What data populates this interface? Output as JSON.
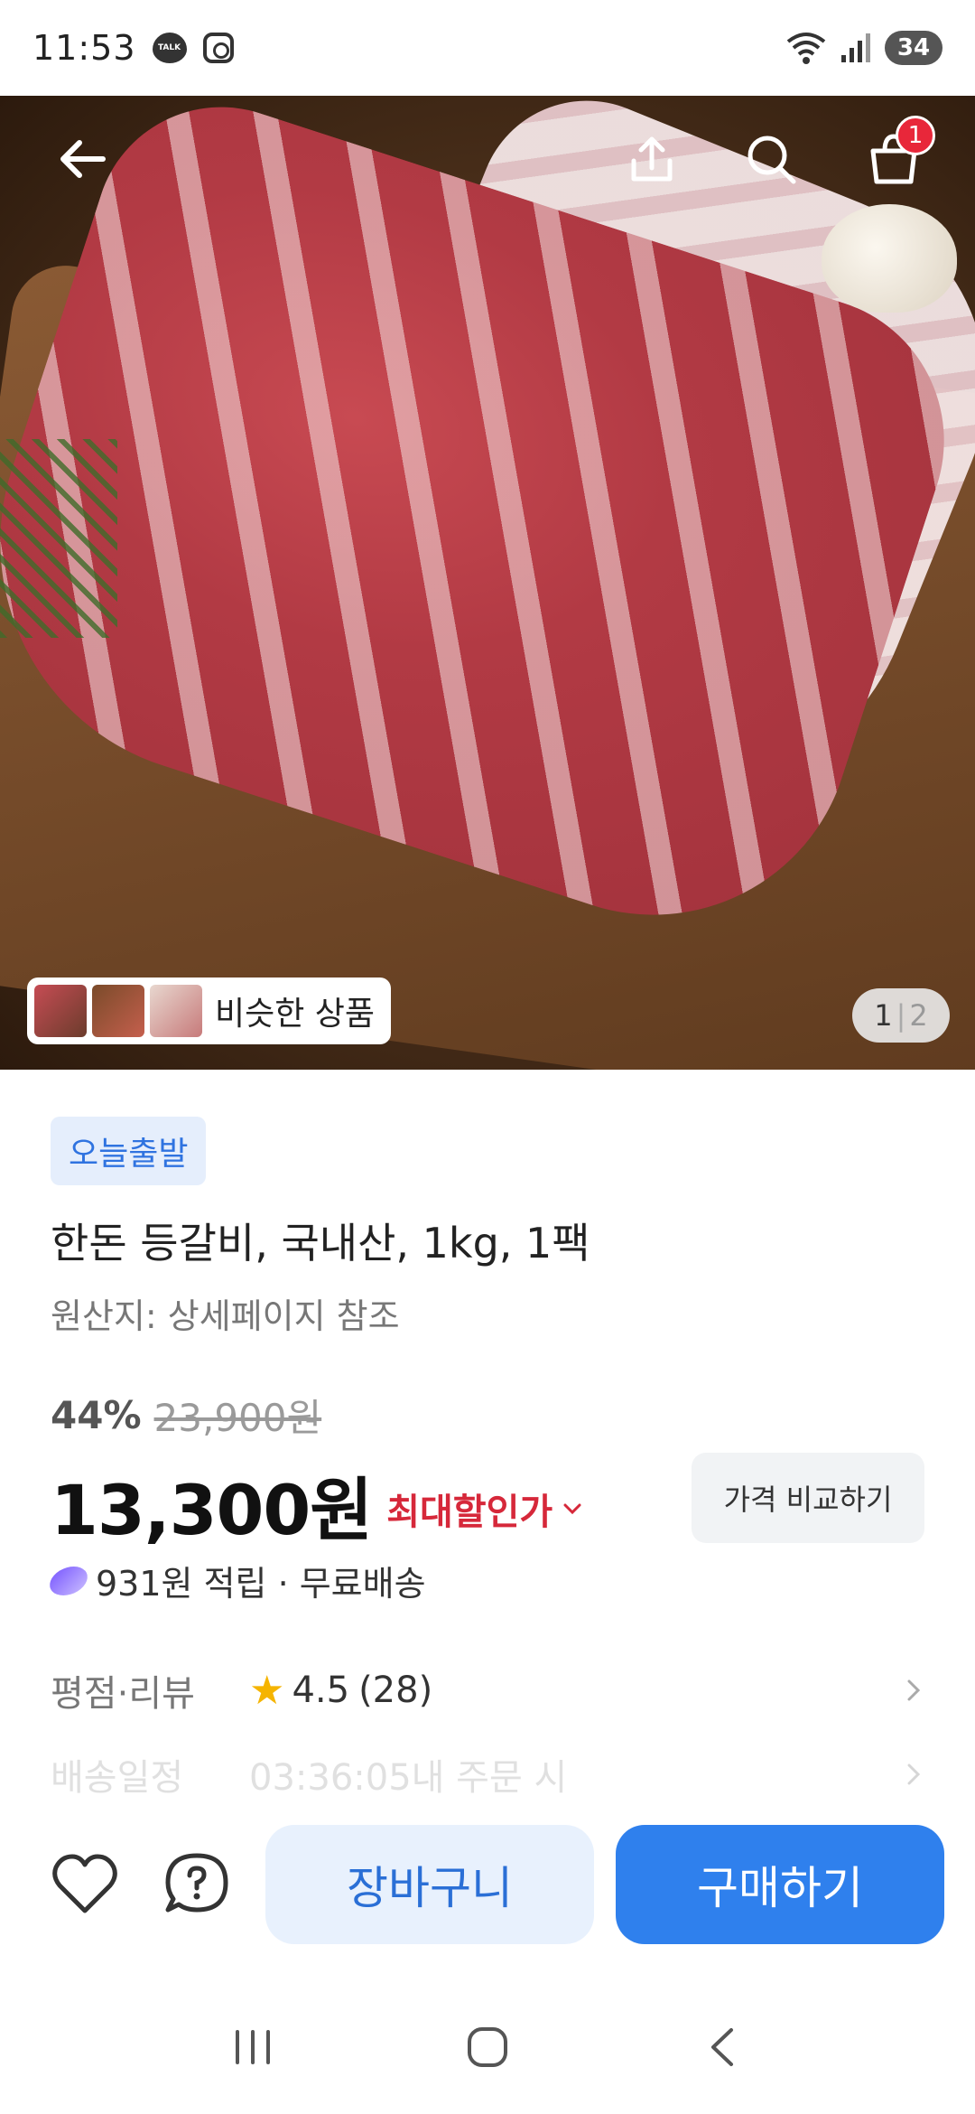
{
  "status_bar": {
    "time": "11:53",
    "battery": "34",
    "talk_label": "TALK"
  },
  "hero": {
    "similar_label": "비슷한 상품",
    "page_current": "1",
    "page_total": "2",
    "cart_count": "1"
  },
  "product": {
    "badge": "오늘출발",
    "title": "한돈 등갈비, 국내산, 1kg, 1팩",
    "origin": "원산지: 상세페이지 참조",
    "discount_pct": "44%",
    "original_price": "23,900원",
    "sale_price": "13,300원",
    "max_discount_label": "최대할인가",
    "compare_label": "가격 비교하기",
    "points_text": "931원 적립 · 무료배송"
  },
  "rating": {
    "label": "평점·리뷰",
    "value": "4.5",
    "count": "(28)"
  },
  "delivery": {
    "label": "배송일정",
    "text": "03:36:05내 주문 시"
  },
  "actions": {
    "cart_label": "장바구니",
    "buy_label": "구매하기"
  },
  "colors": {
    "accent_blue": "#2f80ed",
    "discount_red": "#d6283a",
    "badge_blue_bg": "#e5eefc"
  }
}
